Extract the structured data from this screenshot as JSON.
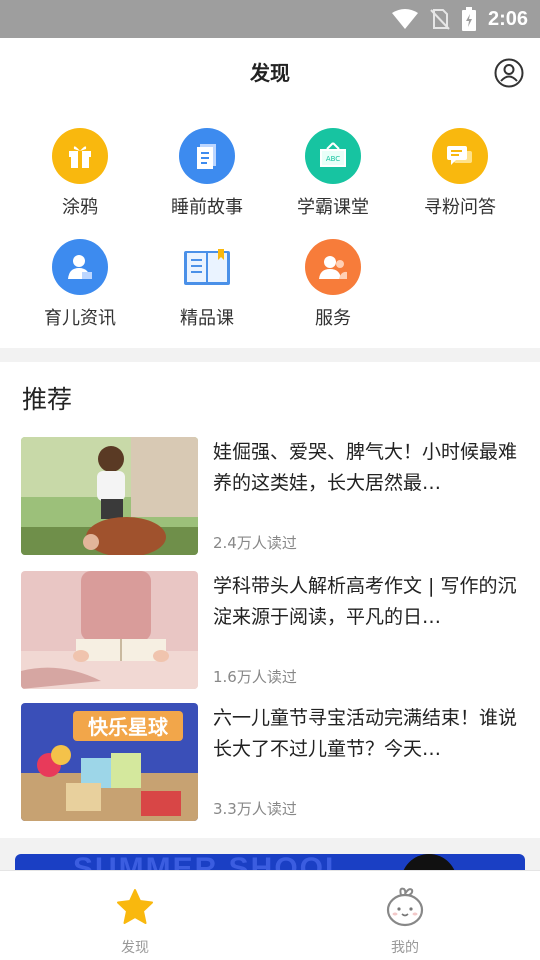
{
  "status_bar": {
    "time": "2:06"
  },
  "header": {
    "title": "发现"
  },
  "grid": [
    {
      "label": "涂鸦",
      "icon": "gift-icon",
      "color": "#f9b80e"
    },
    {
      "label": "睡前故事",
      "icon": "book-icon",
      "color": "#3d8bef"
    },
    {
      "label": "学霸课堂",
      "icon": "blackboard-icon",
      "color": "#17c4a1"
    },
    {
      "label": "寻粉问答",
      "icon": "chat-bubbles-icon",
      "color": "#f9b80e"
    },
    {
      "label": "育儿资讯",
      "icon": "person-icon",
      "color": "#3d8bef"
    },
    {
      "label": "精品课",
      "icon": "open-book-icon",
      "color": "#3d8bef"
    },
    {
      "label": "服务",
      "icon": "group-icon",
      "color": "#f77c3a"
    }
  ],
  "recommend": {
    "title": "推荐",
    "articles": [
      {
        "title": "娃倔强、爱哭、脾气大！小时候最难养的这类娃，长大居然最…",
        "reads": "2.4万人读过"
      },
      {
        "title": "学科带头人解析高考作文 | 写作的沉淀来源于阅读，平凡的日…",
        "reads": "1.6万人读过"
      },
      {
        "title": "六一儿童节寻宝活动完满结束！谁说长大了不过儿童节？今天…",
        "reads": "3.3万人读过"
      }
    ],
    "thumb3_text": "快乐星球"
  },
  "banner": {
    "text": "SUMMER SHOOL"
  },
  "tabbar": {
    "tabs": [
      {
        "label": "发现",
        "icon": "star-icon",
        "active": true
      },
      {
        "label": "我的",
        "icon": "mascot-icon",
        "active": false
      }
    ],
    "active_color": "#f9b80e",
    "inactive_color": "#999999"
  }
}
